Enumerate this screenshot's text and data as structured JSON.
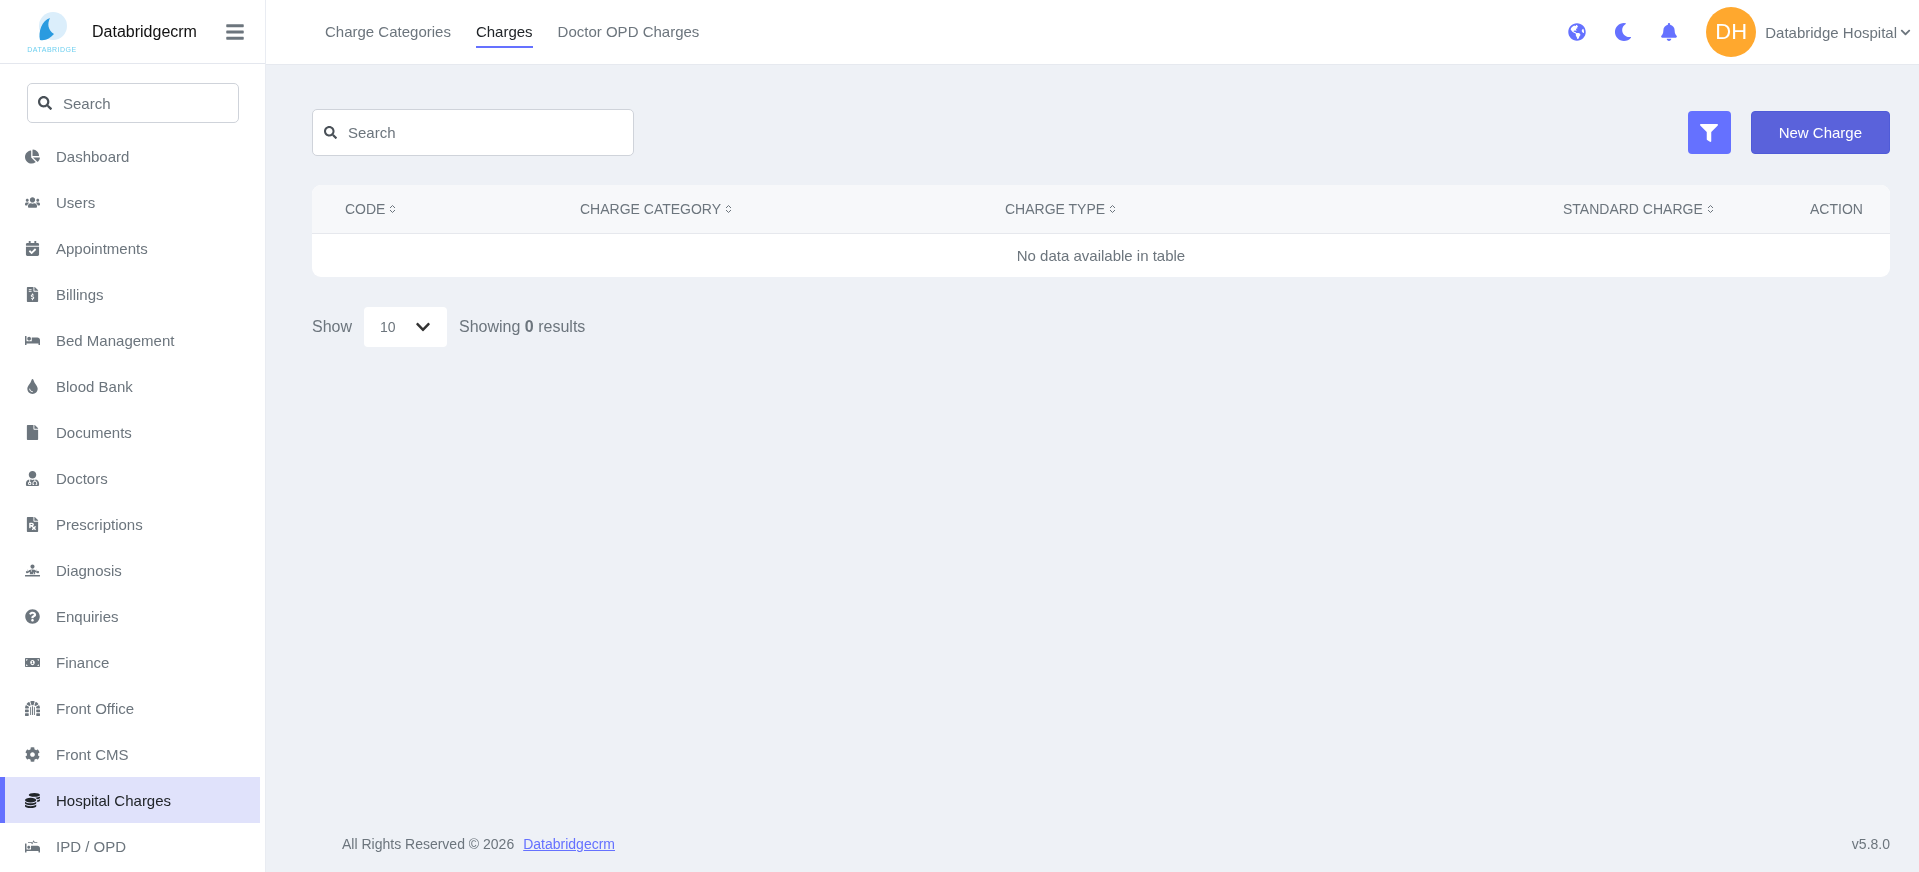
{
  "brand": {
    "logo_text": "DATABRIDGE",
    "name": "Databridgecrm"
  },
  "sidebar": {
    "search": {
      "placeholder": "Search"
    },
    "items": [
      {
        "label": "Dashboard",
        "selected": false
      },
      {
        "label": "Users",
        "selected": false
      },
      {
        "label": "Appointments",
        "selected": false
      },
      {
        "label": "Billings",
        "selected": false
      },
      {
        "label": "Bed Management",
        "selected": false
      },
      {
        "label": "Blood Bank",
        "selected": false
      },
      {
        "label": "Documents",
        "selected": false
      },
      {
        "label": "Doctors",
        "selected": false
      },
      {
        "label": "Prescriptions",
        "selected": false
      },
      {
        "label": "Diagnosis",
        "selected": false
      },
      {
        "label": "Enquiries",
        "selected": false
      },
      {
        "label": "Finance",
        "selected": false
      },
      {
        "label": "Front Office",
        "selected": false
      },
      {
        "label": "Front CMS",
        "selected": false
      },
      {
        "label": "Hospital Charges",
        "selected": true
      },
      {
        "label": "IPD / OPD",
        "selected": false
      }
    ]
  },
  "tabs": [
    {
      "label": "Charge Categories",
      "selected": false
    },
    {
      "label": "Charges",
      "selected": true
    },
    {
      "label": "Doctor OPD Charges",
      "selected": false
    }
  ],
  "user": {
    "initials": "DH",
    "name": "Databridge Hospital"
  },
  "toolbar": {
    "search": {
      "placeholder": "Search"
    },
    "new_button": "New Charge"
  },
  "table": {
    "columns": [
      {
        "label": "CODE",
        "sortable": true
      },
      {
        "label": "CHARGE CATEGORY",
        "sortable": true
      },
      {
        "label": "CHARGE TYPE",
        "sortable": true
      },
      {
        "label": "STANDARD CHARGE",
        "sortable": true
      },
      {
        "label": "ACTION",
        "sortable": false
      }
    ],
    "empty_message": "No data available in table"
  },
  "pagination": {
    "show_label": "Show",
    "page_size": "10",
    "summary": "Showing **0** results"
  },
  "footer": {
    "copyright": "All Rights Reserved © 2026",
    "link": "Databridgecrm",
    "version": "v5.8.0"
  }
}
